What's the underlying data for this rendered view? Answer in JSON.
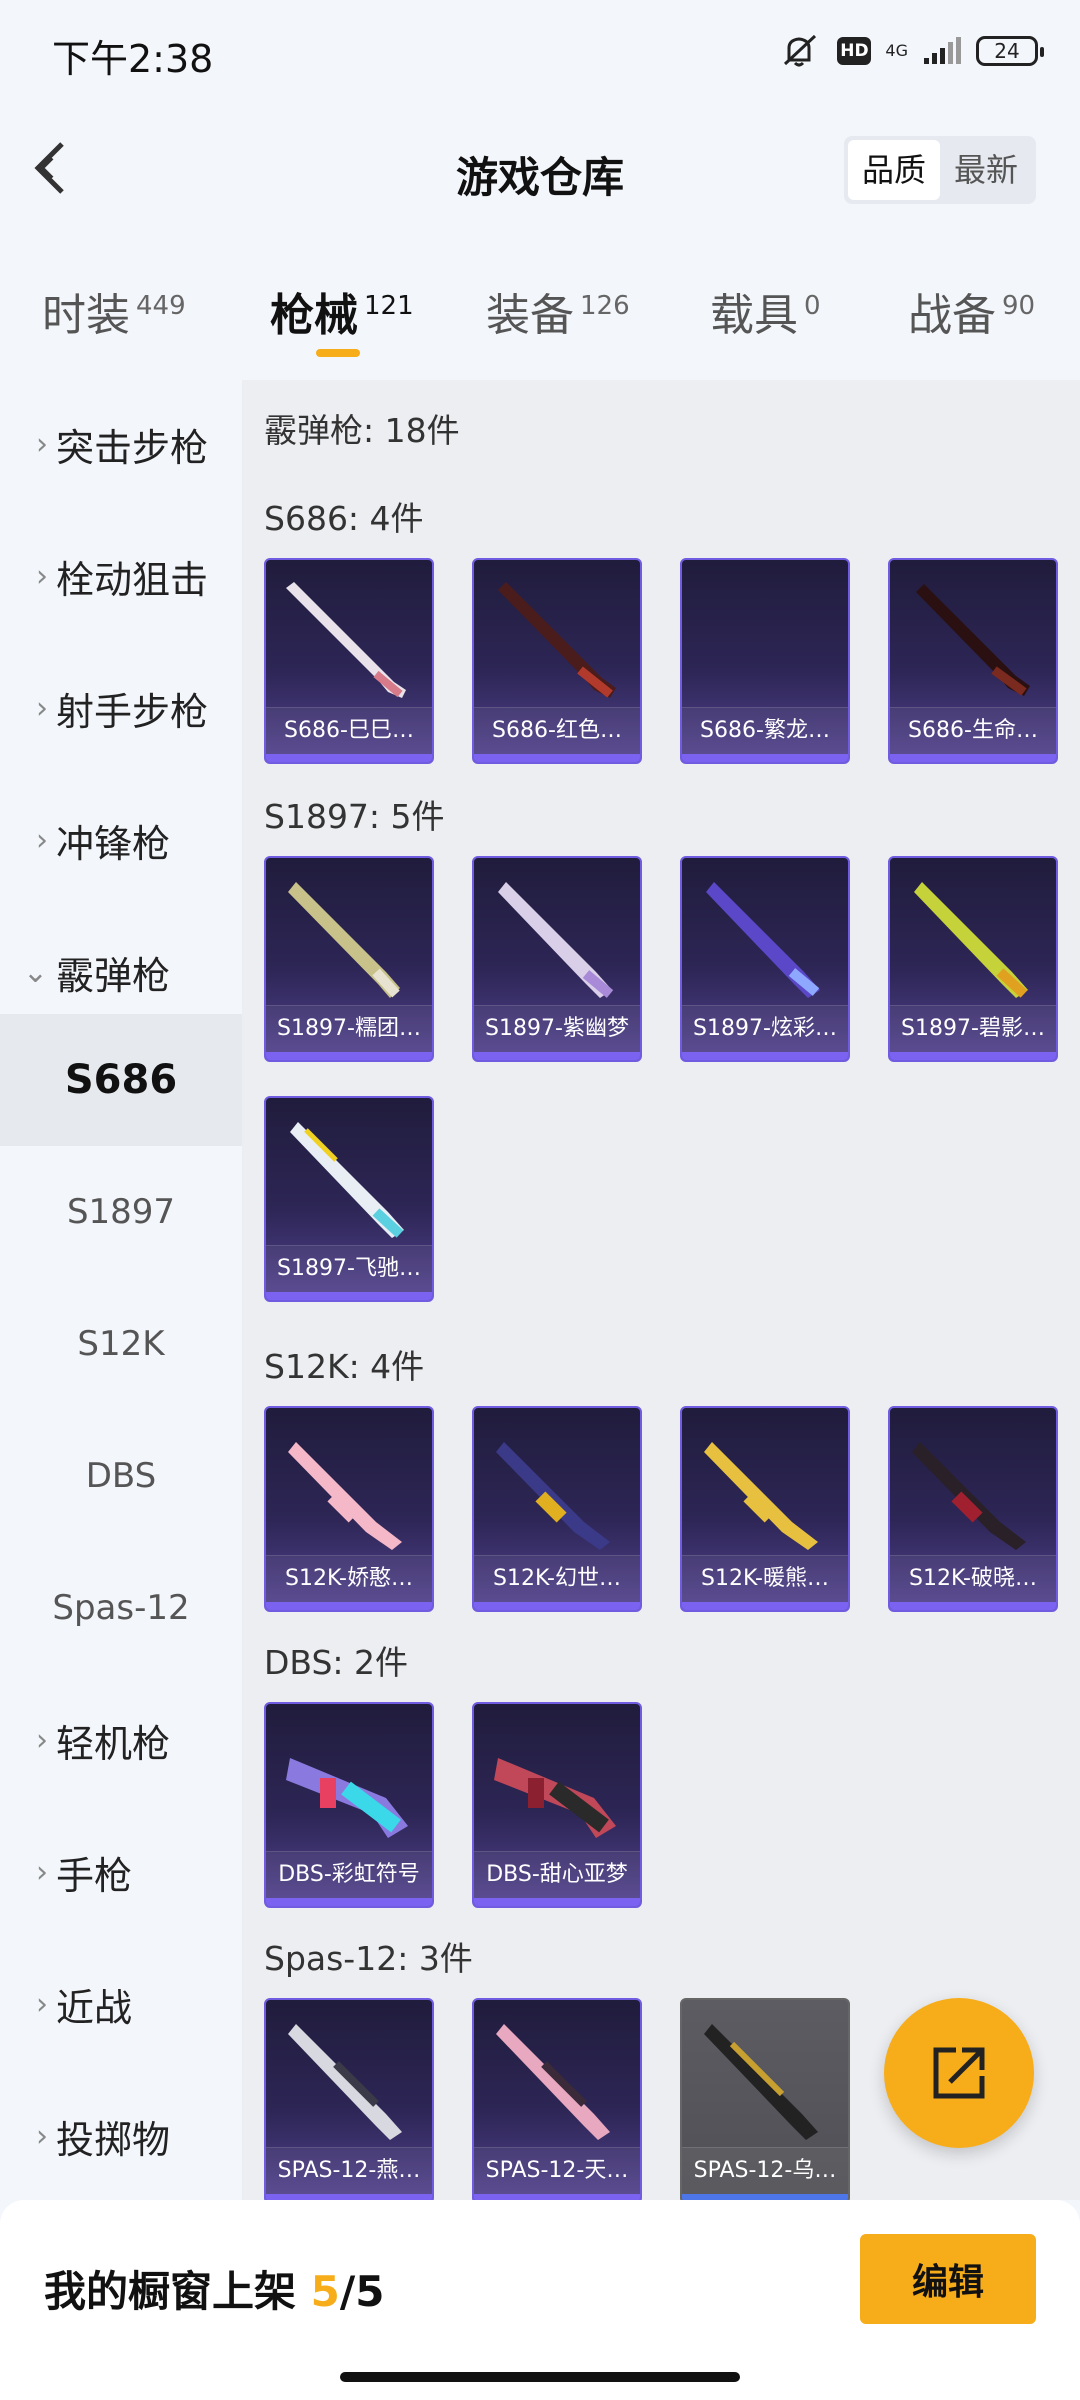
{
  "status_bar": {
    "time": "下午2:38",
    "hd": "HD",
    "net": "4G",
    "battery": "24"
  },
  "header": {
    "title": "游戏仓库",
    "sort_options": [
      "品质",
      "最新"
    ],
    "active_sort": "品质"
  },
  "tabs": [
    {
      "label": "时装",
      "count": "449"
    },
    {
      "label": "枪械",
      "count": "121",
      "active": true
    },
    {
      "label": "装备",
      "count": "126"
    },
    {
      "label": "载具",
      "count": "0"
    },
    {
      "label": "战备",
      "count": "90"
    }
  ],
  "sidebar": {
    "categories": [
      "突击步枪",
      "栓动狙击",
      "射手步枪",
      "冲锋枪",
      "霰弹枪"
    ],
    "subcategories": [
      "S686",
      "S1897",
      "S12K",
      "DBS",
      "Spas-12"
    ],
    "active_sub": "S686",
    "categories_after": [
      "轻机枪",
      "手枪",
      "近战",
      "投掷物"
    ]
  },
  "content": {
    "summary": "霰弹枪: 18件",
    "sections": [
      {
        "title": "S686: 4件",
        "items": [
          "S686-巳巳…",
          "S686-红色…",
          "S686-繁龙…",
          "S686-生命…"
        ]
      },
      {
        "title": "S1897: 5件",
        "items": [
          "S1897-糯团…",
          "S1897-紫幽梦",
          "S1897-炫彩…",
          "S1897-碧影…",
          "S1897-飞驰…"
        ]
      },
      {
        "title": "S12K: 4件",
        "items": [
          "S12K-娇憨…",
          "S12K-幻世…",
          "S12K-暖熊…",
          "S12K-破晓…"
        ]
      },
      {
        "title": "DBS: 2件",
        "items": [
          "DBS-彩虹符号",
          "DBS-甜心亚梦"
        ]
      },
      {
        "title": "Spas-12: 3件",
        "items": [
          "SPAS-12-燕…",
          "SPAS-12-天…",
          "SPAS-12-乌…"
        ]
      }
    ]
  },
  "bottom": {
    "shelf_label": "我的橱窗上架",
    "shelf_current": "5",
    "shelf_total": "/5",
    "edit_label": "编辑"
  },
  "colors": {
    "accent": "#f7ac1a",
    "card_border": "#6f5ce0"
  }
}
